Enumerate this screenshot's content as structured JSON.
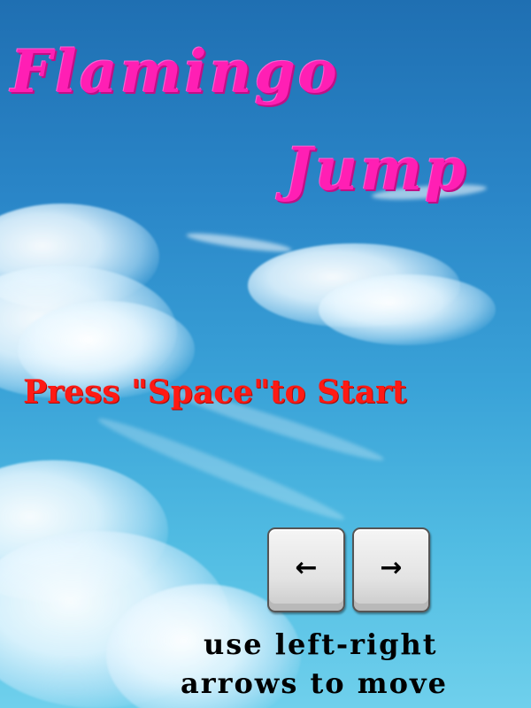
{
  "game": {
    "title_line1": "Flamingo",
    "title_line2": "Jump",
    "start_prompt": "Press \"Space\"to Start",
    "controls": {
      "left_key_icon": "left-arrow-icon",
      "left_key_glyph": "←",
      "right_key_icon": "right-arrow-icon",
      "right_key_glyph": "→",
      "hint_line1": "use left-right",
      "hint_line2": "arrows to move"
    },
    "colors": {
      "title": "#ff1fb4",
      "start_prompt": "#ff1a14",
      "hint": "#000000",
      "sky_top": "#1f6fb2",
      "sky_bottom": "#6fd0ec"
    }
  }
}
